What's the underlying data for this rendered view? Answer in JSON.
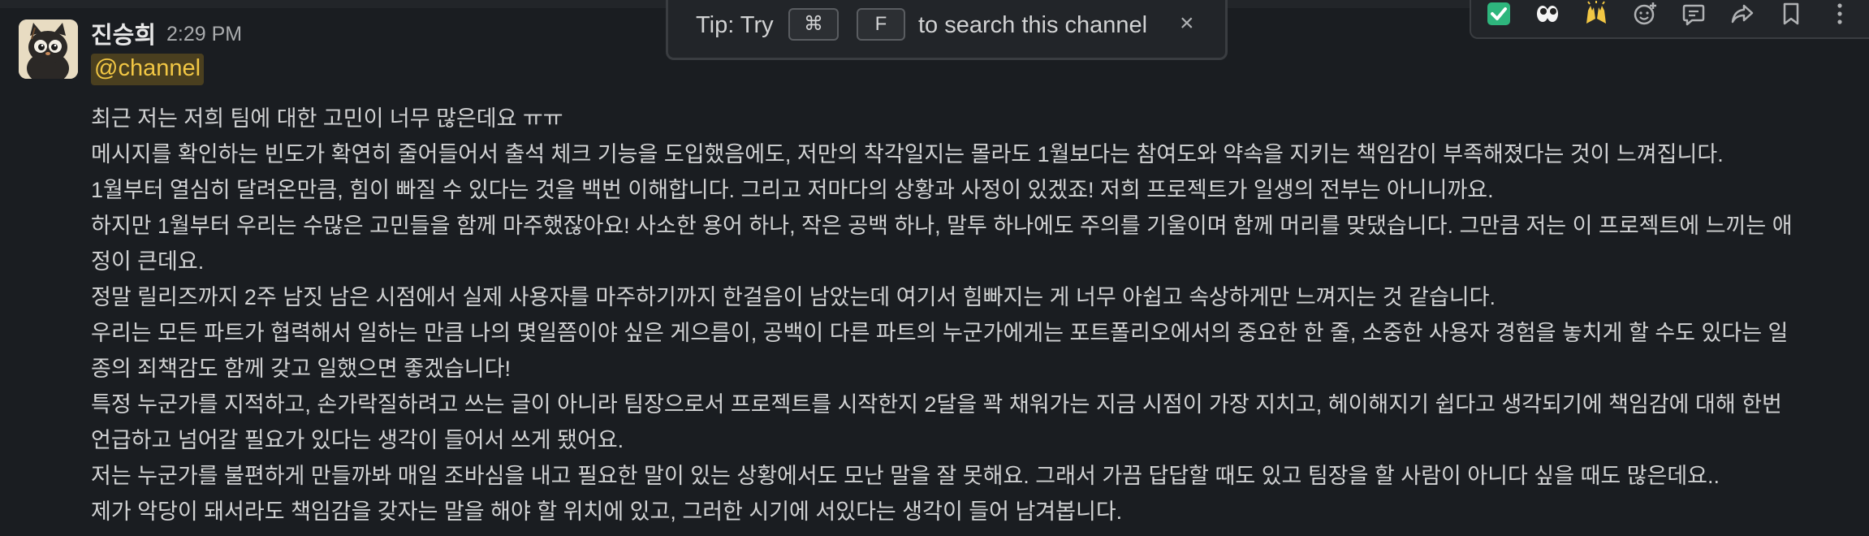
{
  "message": {
    "sender": "진승희",
    "time": "2:29 PM",
    "mention": "@channel",
    "lines": [
      "최근 저는 저희 팀에 대한 고민이 너무 많은데요 ㅠㅠ",
      "메시지를 확인하는 빈도가 확연히 줄어들어서 출석 체크 기능을 도입했음에도, 저만의 착각일지는 몰라도 1월보다는 참여도와 약속을 지키는 책임감이 부족해졌다는 것이 느껴집니다.",
      "1월부터 열심히 달려온만큼, 힘이 빠질 수 있다는 것을 백번 이해합니다. 그리고 저마다의 상황과 사정이 있겠죠! 저희 프로젝트가 일생의 전부는 아니니까요.",
      "하지만 1월부터 우리는 수많은 고민들을 함께 마주했잖아요! 사소한 용어 하나, 작은 공백 하나, 말투 하나에도 주의를 기울이며 함께 머리를 맞댔습니다. 그만큼 저는 이 프로젝트에 느끼는 애",
      "정이 큰데요.",
      "정말 릴리즈까지 2주 남짓 남은 시점에서 실제 사용자를 마주하기까지 한걸음이 남았는데 여기서 힘빠지는 게 너무 아쉽고 속상하게만 느껴지는 것 같습니다.",
      "우리는 모든 파트가 협력해서 일하는 만큼 나의 몇일쯤이야 싶은 게으름이, 공백이 다른 파트의 누군가에게는 포트폴리오에서의 중요한 한 줄, 소중한 사용자 경험을 놓치게 할 수도 있다는 일",
      "종의 죄책감도 함께 갖고 일했으면 좋겠습니다!",
      "특정 누군가를 지적하고, 손가락질하려고 쓰는 글이 아니라 팀장으로서 프로젝트를 시작한지 2달을 꽉 채워가는 지금 시점이 가장 지치고, 헤이해지기 쉽다고 생각되기에 책임감에 대해 한번",
      "언급하고 넘어갈 필요가 있다는 생각이 들어서 쓰게 됐어요.",
      "저는 누군가를 불편하게 만들까봐 매일 조바심을 내고 필요한 말이 있는 상황에서도 모난 말을 잘 못해요. 그래서 가끔 답답할 때도 있고 팀장을 할 사람이 아니다 싶을 때도 많은데요..",
      "제가 악당이 돼서라도 책임감을 갖자는 말을 해야 할 위치에 있고, 그러한 시기에 서있다는 생각이 들어 남겨봅니다."
    ]
  },
  "tip": {
    "prefix": "Tip: Try",
    "key1": "⌘",
    "key2": "F",
    "suffix": "to search this channel",
    "close": "×"
  },
  "actions": {
    "icons": [
      "check-mark-emoji-icon",
      "eyes-emoji-icon",
      "raised-hands-emoji-icon",
      "add-reaction-icon",
      "reply-in-thread-icon",
      "share-icon",
      "bookmark-icon",
      "more-actions-icon"
    ],
    "check_color": "#2eb67d",
    "raised_hands_color": "#f2c744"
  },
  "colors": {
    "background": "#1a1d21",
    "mention_text": "#f2c744",
    "mention_bg": "#4a3f1f"
  }
}
